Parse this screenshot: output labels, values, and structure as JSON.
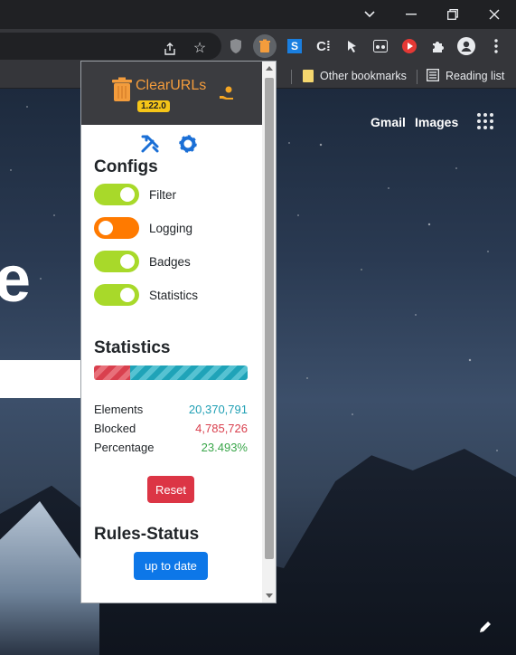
{
  "browser": {
    "bookmarks": {
      "other_label": "Other bookmarks",
      "reading_list_label": "Reading list"
    }
  },
  "page": {
    "links": {
      "gmail": "Gmail",
      "images": "Images"
    },
    "hero_letter": "e"
  },
  "popup": {
    "brand": "ClearURLs",
    "version": "1.22.0",
    "configs": {
      "title": "Configs",
      "toggles": [
        {
          "label": "Filter",
          "on": true
        },
        {
          "label": "Logging",
          "on": false
        },
        {
          "label": "Badges",
          "on": true
        },
        {
          "label": "Statistics",
          "on": true
        }
      ]
    },
    "statistics": {
      "title": "Statistics",
      "blocked_fraction": 0.23493,
      "rows": {
        "elements": {
          "label": "Elements",
          "value": "20,370,791"
        },
        "blocked": {
          "label": "Blocked",
          "value": "4,785,726"
        },
        "percentage": {
          "label": "Percentage",
          "value": "23.493%"
        }
      },
      "reset_label": "Reset"
    },
    "rules_status": {
      "title": "Rules-Status",
      "button_label": "up to date"
    }
  },
  "colors": {
    "toggle_on": "#a8d92a",
    "toggle_off": "#ff7a00",
    "reset": "#dc3545",
    "primary": "#0d77e8",
    "brand": "#f39c3c"
  }
}
